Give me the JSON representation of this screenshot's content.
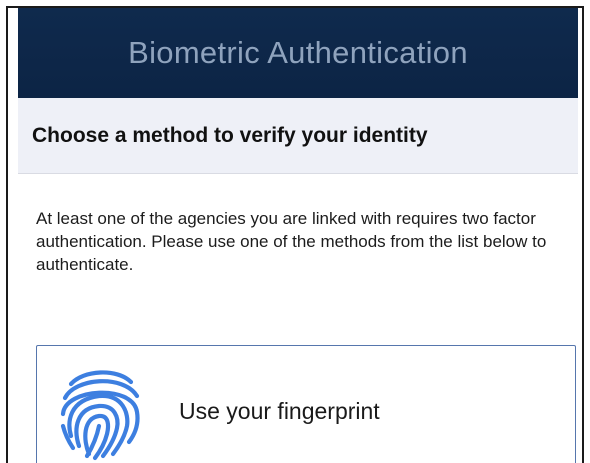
{
  "header": {
    "title": "Biometric Authentication"
  },
  "subheader": {
    "title": "Choose a method to verify your identity"
  },
  "main": {
    "description": "At least one of the agencies you are linked with requires two factor authentication. Please use one of the methods from the list below to authenticate.",
    "methods": [
      {
        "label": "Use your fingerprint",
        "icon": "fingerprint-icon"
      }
    ]
  },
  "colors": {
    "header_bg": "#0f2a4d",
    "header_text": "#8fa3bd",
    "subheader_bg": "#eef0f7",
    "card_border": "#5676ad",
    "icon_blue": "#3d7fe0"
  }
}
